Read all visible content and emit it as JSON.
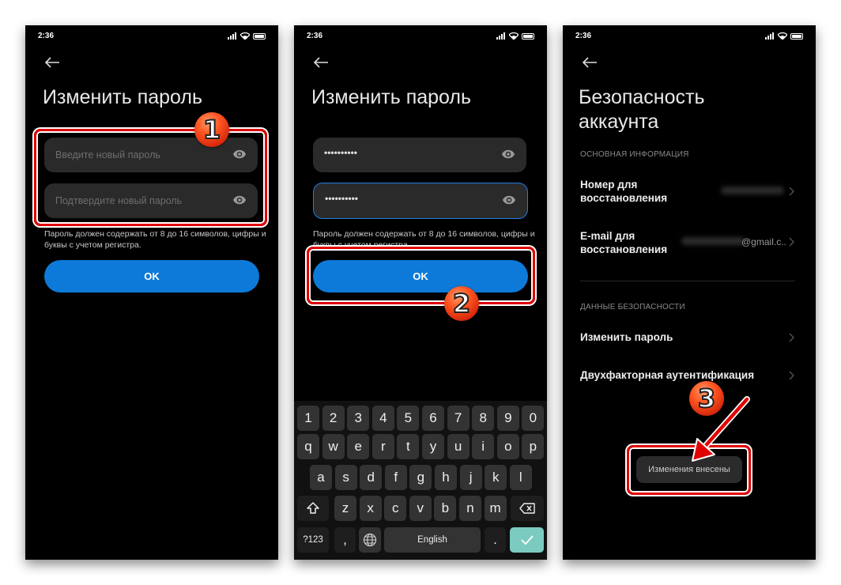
{
  "status_bar": {
    "time": "2:36"
  },
  "screen1": {
    "title": "Изменить пароль",
    "new_password_placeholder": "Введите новый пароль",
    "confirm_password_placeholder": "Подтвердите новый пароль",
    "hint": "Пароль должен содержать от 8 до 16 символов, цифры и буквы с учетом регистра.",
    "ok_label": "OK",
    "step_badge": "1"
  },
  "screen2": {
    "title": "Изменить пароль",
    "new_password_value": "••••••••••",
    "confirm_password_value": "••••••••••",
    "hint": "Пароль должен содержать от 8 до 16 символов, цифры и буквы с учетом регистра.",
    "ok_label": "OK",
    "step_badge": "2",
    "keyboard": {
      "row1": [
        "1",
        "2",
        "3",
        "4",
        "5",
        "6",
        "7",
        "8",
        "9",
        "0"
      ],
      "row2": [
        "q",
        "w",
        "e",
        "r",
        "t",
        "y",
        "u",
        "i",
        "o",
        "p"
      ],
      "row3": [
        "a",
        "s",
        "d",
        "f",
        "g",
        "h",
        "j",
        "k",
        "l"
      ],
      "row4": [
        "z",
        "x",
        "c",
        "v",
        "b",
        "n",
        "m"
      ],
      "symbols_label": "?123",
      "comma": ",",
      "space_label": "English",
      "period": ".",
      "shift_icon": "shift-icon",
      "backspace_icon": "backspace-icon",
      "globe_icon": "globe-icon",
      "enter_icon": "check-icon"
    }
  },
  "screen3": {
    "title_line1": "Безопасность",
    "title_line2": "аккаунта",
    "section_basic": "ОСНОВНАЯ ИНФОРМАЦИЯ",
    "recovery_phone_line1": "Номер для",
    "recovery_phone_line2": "восстановления",
    "recovery_email_line1": "E-mail для",
    "recovery_email_line2": "восстановления",
    "recovery_email_value": "@gmail.c..",
    "section_security": "ДАННЫЕ БЕЗОПАСНОСТИ",
    "change_password": "Изменить пароль",
    "two_factor": "Двухфакторная аутентификация",
    "toast": "Изменения внесены",
    "step_badge": "3"
  },
  "colors": {
    "accent": "#0d7ad9",
    "highlight": "#e00000",
    "badge": "#ff5722",
    "enter_key": "#7ccbc1"
  }
}
